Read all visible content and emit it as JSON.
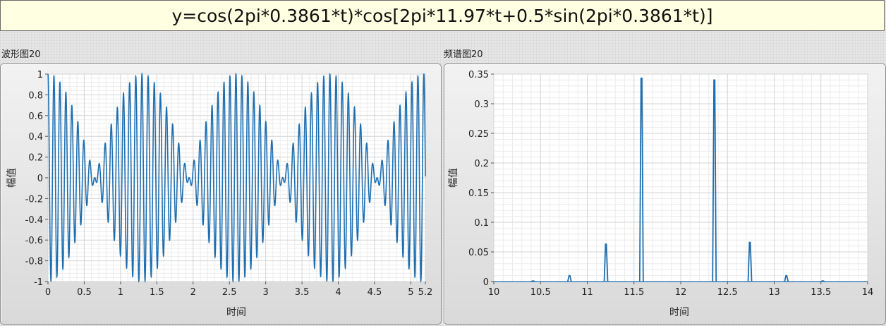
{
  "formula": "y=cos(2pi*0.3861*t)*cos[2pi*11.97*t+0.5*sin(2pi*0.3861*t)]",
  "colors": {
    "trace": "#1f6fb0",
    "plot_bg": "#ffffff",
    "grid": "#d4d4d4",
    "minor_grid": "#ececec"
  },
  "chart_data": [
    {
      "type": "line",
      "title": "波形图20",
      "xlabel": "时间",
      "ylabel": "幅值",
      "xlim": [
        0,
        5.2
      ],
      "ylim": [
        -1,
        1
      ],
      "xticks": [
        "0",
        "0.5",
        "1",
        "1.5",
        "2",
        "2.5",
        "3",
        "3.5",
        "4",
        "4.5",
        "5",
        "5.2"
      ],
      "xtick_values": [
        0,
        0.5,
        1,
        1.5,
        2,
        2.5,
        3,
        3.5,
        4,
        4.5,
        5,
        5.2
      ],
      "yticks": [
        "1",
        "0.8",
        "0.6",
        "0.4",
        "0.2",
        "0",
        "-0.2",
        "-0.4",
        "-0.6",
        "-0.8",
        "-1"
      ],
      "ytick_values": [
        1,
        0.8,
        0.6,
        0.4,
        0.2,
        0,
        -0.2,
        -0.4,
        -0.6,
        -0.8,
        -1
      ],
      "grid": true,
      "signal": {
        "carrier_hz": 11.97,
        "envelope_hz": 0.3861,
        "mod_index": 0.5
      }
    },
    {
      "type": "line",
      "title": "频谱图20",
      "xlabel": "时间",
      "ylabel": "幅值",
      "xlim": [
        10,
        14
      ],
      "ylim": [
        0,
        0.35
      ],
      "xticks": [
        "10",
        "10.5",
        "11",
        "11.5",
        "12",
        "12.5",
        "13",
        "13.5",
        "14"
      ],
      "xtick_values": [
        10,
        10.5,
        11,
        11.5,
        12,
        12.5,
        13,
        13.5,
        14
      ],
      "yticks": [
        "0.35",
        "0.3",
        "0.25",
        "0.2",
        "0.15",
        "0.1",
        "0.05",
        "0"
      ],
      "ytick_values": [
        0.35,
        0.3,
        0.25,
        0.2,
        0.15,
        0.1,
        0.05,
        0
      ],
      "grid": true,
      "peaks": [
        {
          "x": 10.42,
          "y": 0.001
        },
        {
          "x": 10.81,
          "y": 0.01
        },
        {
          "x": 11.2,
          "y": 0.063
        },
        {
          "x": 11.58,
          "y": 0.343
        },
        {
          "x": 12.36,
          "y": 0.34
        },
        {
          "x": 12.74,
          "y": 0.066
        },
        {
          "x": 13.13,
          "y": 0.01
        },
        {
          "x": 13.52,
          "y": 0.001
        }
      ]
    }
  ]
}
